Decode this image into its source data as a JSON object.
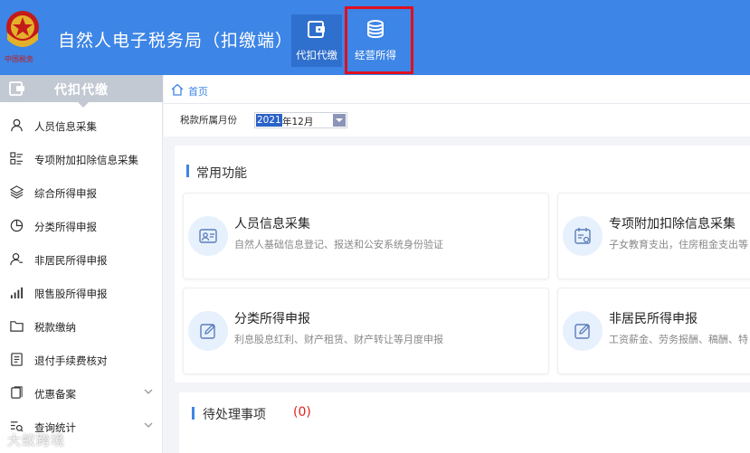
{
  "header": {
    "title": "自然人电子税务局（扣缴端）",
    "tabs": [
      {
        "label": "代扣代缴",
        "active": true,
        "icon": "wallet-icon"
      },
      {
        "label": "经营所得",
        "active": false,
        "icon": "coins-icon",
        "highlighted": true
      }
    ],
    "highlight_color": "#e0101e"
  },
  "sidebar": {
    "title": "代扣代缴",
    "items": [
      {
        "label": "人员信息采集",
        "icon": "person-icon"
      },
      {
        "label": "专项附加扣除信息采集",
        "icon": "list-icon"
      },
      {
        "label": "综合所得申报",
        "icon": "layers-icon"
      },
      {
        "label": "分类所得申报",
        "icon": "pie-icon"
      },
      {
        "label": "非居民所得申报",
        "icon": "user-outline-icon"
      },
      {
        "label": "限售股所得申报",
        "icon": "bar-signal-icon"
      },
      {
        "label": "税款缴纳",
        "icon": "folder-icon"
      },
      {
        "label": "退付手续费核对",
        "icon": "document-icon"
      },
      {
        "label": "优惠备案",
        "icon": "copy-icon",
        "expandable": true
      },
      {
        "label": "查询统计",
        "icon": "search-list-icon",
        "expandable": true
      }
    ]
  },
  "breadcrumb": {
    "home": "首页"
  },
  "filter": {
    "label": "税款所属月份",
    "year": "2021",
    "rest": "年12月"
  },
  "functions": {
    "title": "常用功能",
    "cards": [
      {
        "title": "人员信息采集",
        "desc": "自然人基础信息登记、报送和公安系统身份验证",
        "icon": "id-card-icon"
      },
      {
        "title": "专项附加扣除信息采集",
        "desc": "子女教育支出，住房租金支出等",
        "icon": "calendar-check-icon"
      },
      {
        "title": "分类所得申报",
        "desc": "利息股息红利、财产租赁、财产转让等月度申报",
        "icon": "edit-icon"
      },
      {
        "title": "非居民所得申报",
        "desc": "工资薪金、劳务报酬、稿酬、特",
        "icon": "edit-icon"
      }
    ]
  },
  "pending": {
    "title": "待处理事项",
    "count": "(0)"
  },
  "watermark": "大蚁跨境",
  "colors": {
    "brand_blue": "#3d85e6",
    "accent_red": "#e0101e"
  }
}
